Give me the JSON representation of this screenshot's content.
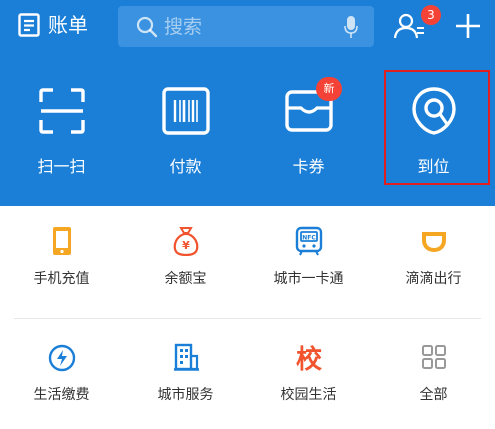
{
  "topbar": {
    "bill_label": "账单",
    "search_placeholder": "搜索",
    "notification_count": "3"
  },
  "quick_actions": [
    {
      "label": "扫一扫",
      "icon": "scan-icon"
    },
    {
      "label": "付款",
      "icon": "barcode-icon"
    },
    {
      "label": "卡券",
      "icon": "card-wallet-icon",
      "badge": "新"
    },
    {
      "label": "到位",
      "icon": "location-pin-icon"
    }
  ],
  "grid": {
    "row1": [
      {
        "label": "手机充值",
        "icon": "phone-icon"
      },
      {
        "label": "余额宝",
        "icon": "money-bag-icon"
      },
      {
        "label": "城市一卡通",
        "icon": "transit-card-icon"
      },
      {
        "label": "滴滴出行",
        "icon": "didi-icon"
      }
    ],
    "row2": [
      {
        "label": "生活缴费",
        "icon": "utility-drop-icon"
      },
      {
        "label": "城市服务",
        "icon": "city-building-icon"
      },
      {
        "label": "校园生活",
        "icon": "school-icon",
        "glyph": "校"
      },
      {
        "label": "全部",
        "icon": "all-grid-icon"
      }
    ]
  },
  "colors": {
    "header_blue": "#1b7fd8",
    "badge_red": "#f44336",
    "highlight_red": "#e02020"
  }
}
